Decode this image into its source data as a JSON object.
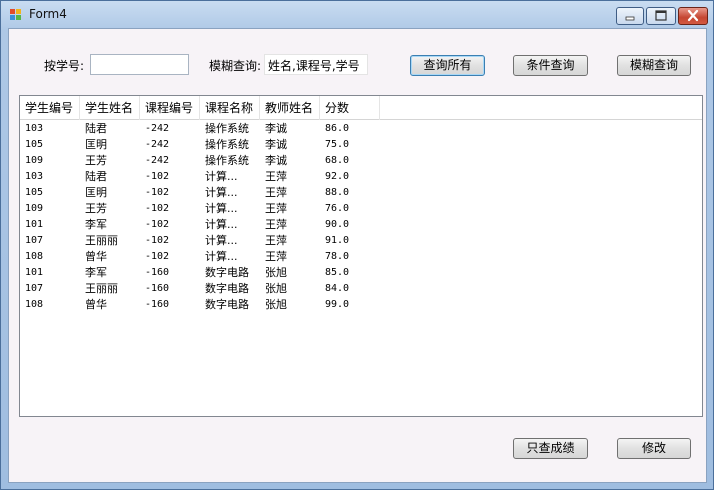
{
  "window": {
    "title": "Form4"
  },
  "search": {
    "student_id_label": "按学号:",
    "student_id_value": "",
    "fuzzy_label": "模糊查询:",
    "fuzzy_value": "姓名,课程号,学号",
    "query_all_label": "查询所有",
    "conditional_query_label": "条件查询",
    "fuzzy_query_label": "模糊查询"
  },
  "table": {
    "columns": [
      "学生编号",
      "学生姓名",
      "课程编号",
      "课程名称",
      "教师姓名",
      "分数"
    ],
    "rows": [
      [
        "103",
        "陆君",
        "-242",
        "操作系统",
        "李诚",
        "86.0"
      ],
      [
        "105",
        "匡明",
        "-242",
        "操作系统",
        "李诚",
        "75.0"
      ],
      [
        "109",
        "王芳",
        "-242",
        "操作系统",
        "李诚",
        "68.0"
      ],
      [
        "103",
        "陆君",
        "-102",
        "计算...",
        "王萍",
        "92.0"
      ],
      [
        "105",
        "匡明",
        "-102",
        "计算...",
        "王萍",
        "88.0"
      ],
      [
        "109",
        "王芳",
        "-102",
        "计算...",
        "王萍",
        "76.0"
      ],
      [
        "101",
        "李军",
        "-102",
        "计算...",
        "王萍",
        "90.0"
      ],
      [
        "107",
        "王丽丽",
        "-102",
        "计算...",
        "王萍",
        "91.0"
      ],
      [
        "108",
        "曾华",
        "-102",
        "计算...",
        "王萍",
        "78.0"
      ],
      [
        "101",
        "李军",
        "-160",
        "数字电路",
        "张旭",
        "85.0"
      ],
      [
        "107",
        "王丽丽",
        "-160",
        "数字电路",
        "张旭",
        "84.0"
      ],
      [
        "108",
        "曾华",
        "-160",
        "数字电路",
        "张旭",
        "99.0"
      ]
    ]
  },
  "footer": {
    "scores_only_label": "只查成绩",
    "edit_label": "修改"
  },
  "colors": {
    "titlebar": "#c9dcf1",
    "client_bg": "#f7f3f7",
    "close_button": "#c54632"
  },
  "icons": {
    "app": "app-icon",
    "minimize": "minimize-icon",
    "maximize": "maximize-icon",
    "close": "close-icon"
  }
}
